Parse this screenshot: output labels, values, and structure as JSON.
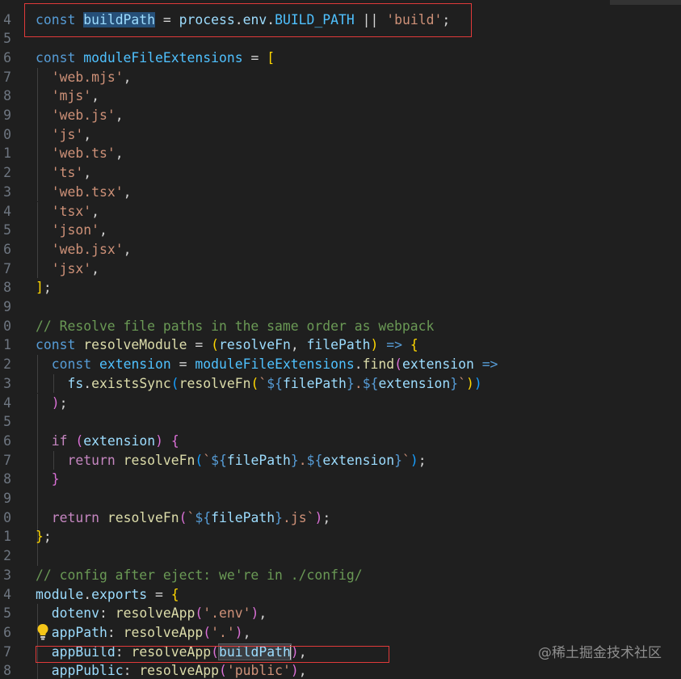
{
  "editor": {
    "colors": {
      "background": "#1f1f1f",
      "line_number": "#6e7681",
      "keyword": "#569cd6",
      "variable": "#9cdcfe",
      "constant": "#4fc1ff",
      "function": "#dcdcaa",
      "string": "#ce9178",
      "comment": "#6a9955",
      "control": "#c586c0",
      "punctuation": "#d4d4d4",
      "bracket_gold": "#ffd700",
      "bracket_pink": "#da70d6",
      "bracket_blue": "#179fff",
      "annotation_box": "#e03a3a"
    },
    "lines": [
      {
        "num": "4",
        "tokens": [
          [
            "const",
            "k"
          ],
          [
            " ",
            "p"
          ],
          [
            "buildPath",
            "vsel"
          ],
          [
            " = ",
            "p"
          ],
          [
            "process",
            "v"
          ],
          [
            ".",
            "p"
          ],
          [
            "env",
            "v"
          ],
          [
            ".",
            "p"
          ],
          [
            "BUILD_PATH",
            "c"
          ],
          [
            " || ",
            "p"
          ],
          [
            "'build'",
            "s"
          ],
          [
            ";",
            "p"
          ]
        ]
      },
      {
        "num": "5",
        "tokens": []
      },
      {
        "num": "6",
        "tokens": [
          [
            "const",
            "k"
          ],
          [
            " ",
            "p"
          ],
          [
            "moduleFileExtensions",
            "c"
          ],
          [
            " = ",
            "p"
          ],
          [
            "[",
            "b1"
          ]
        ]
      },
      {
        "num": "7",
        "tokens": [
          [
            "  ",
            "p"
          ],
          [
            "'web.mjs'",
            "s"
          ],
          [
            ",",
            "p"
          ]
        ]
      },
      {
        "num": "8",
        "tokens": [
          [
            "  ",
            "p"
          ],
          [
            "'mjs'",
            "s"
          ],
          [
            ",",
            "p"
          ]
        ]
      },
      {
        "num": "9",
        "tokens": [
          [
            "  ",
            "p"
          ],
          [
            "'web.js'",
            "s"
          ],
          [
            ",",
            "p"
          ]
        ]
      },
      {
        "num": "0",
        "tokens": [
          [
            "  ",
            "p"
          ],
          [
            "'js'",
            "s"
          ],
          [
            ",",
            "p"
          ]
        ]
      },
      {
        "num": "1",
        "tokens": [
          [
            "  ",
            "p"
          ],
          [
            "'web.ts'",
            "s"
          ],
          [
            ",",
            "p"
          ]
        ]
      },
      {
        "num": "2",
        "tokens": [
          [
            "  ",
            "p"
          ],
          [
            "'ts'",
            "s"
          ],
          [
            ",",
            "p"
          ]
        ]
      },
      {
        "num": "3",
        "tokens": [
          [
            "  ",
            "p"
          ],
          [
            "'web.tsx'",
            "s"
          ],
          [
            ",",
            "p"
          ]
        ]
      },
      {
        "num": "4",
        "tokens": [
          [
            "  ",
            "p"
          ],
          [
            "'tsx'",
            "s"
          ],
          [
            ",",
            "p"
          ]
        ]
      },
      {
        "num": "5",
        "tokens": [
          [
            "  ",
            "p"
          ],
          [
            "'json'",
            "s"
          ],
          [
            ",",
            "p"
          ]
        ]
      },
      {
        "num": "6",
        "tokens": [
          [
            "  ",
            "p"
          ],
          [
            "'web.jsx'",
            "s"
          ],
          [
            ",",
            "p"
          ]
        ]
      },
      {
        "num": "7",
        "tokens": [
          [
            "  ",
            "p"
          ],
          [
            "'jsx'",
            "s"
          ],
          [
            ",",
            "p"
          ]
        ]
      },
      {
        "num": "8",
        "tokens": [
          [
            "]",
            "b1"
          ],
          [
            ";",
            "p"
          ]
        ]
      },
      {
        "num": "9",
        "tokens": []
      },
      {
        "num": "0",
        "tokens": [
          [
            "// Resolve file paths in the same order as webpack",
            "cm"
          ]
        ]
      },
      {
        "num": "1",
        "tokens": [
          [
            "const",
            "k"
          ],
          [
            " ",
            "p"
          ],
          [
            "resolveModule",
            "f"
          ],
          [
            " = ",
            "p"
          ],
          [
            "(",
            "b1"
          ],
          [
            "resolveFn",
            "v"
          ],
          [
            ", ",
            "p"
          ],
          [
            "filePath",
            "v"
          ],
          [
            ")",
            "b1"
          ],
          [
            " ",
            "p"
          ],
          [
            "=>",
            "k"
          ],
          [
            " ",
            "p"
          ],
          [
            "{",
            "b1"
          ]
        ]
      },
      {
        "num": "2",
        "tokens": [
          [
            "  ",
            "p"
          ],
          [
            "const",
            "k"
          ],
          [
            " ",
            "p"
          ],
          [
            "extension",
            "c"
          ],
          [
            " = ",
            "p"
          ],
          [
            "moduleFileExtensions",
            "c"
          ],
          [
            ".",
            "p"
          ],
          [
            "find",
            "f"
          ],
          [
            "(",
            "b2"
          ],
          [
            "extension",
            "v"
          ],
          [
            " ",
            "p"
          ],
          [
            "=>",
            "k"
          ]
        ]
      },
      {
        "num": "3",
        "tokens": [
          [
            "    ",
            "p"
          ],
          [
            "fs",
            "v"
          ],
          [
            ".",
            "p"
          ],
          [
            "existsSync",
            "f"
          ],
          [
            "(",
            "b3"
          ],
          [
            "resolveFn",
            "f"
          ],
          [
            "(",
            "b1"
          ],
          [
            "`",
            "s"
          ],
          [
            "${",
            "k"
          ],
          [
            "filePath",
            "v"
          ],
          [
            "}",
            "k"
          ],
          [
            ".",
            "s"
          ],
          [
            "${",
            "k"
          ],
          [
            "extension",
            "v"
          ],
          [
            "}",
            "k"
          ],
          [
            "`",
            "s"
          ],
          [
            ")",
            "b1"
          ],
          [
            ")",
            "b3"
          ]
        ]
      },
      {
        "num": "4",
        "tokens": [
          [
            "  ",
            "p"
          ],
          [
            ")",
            "b2"
          ],
          [
            ";",
            "p"
          ]
        ]
      },
      {
        "num": "5",
        "tokens": []
      },
      {
        "num": "6",
        "tokens": [
          [
            "  ",
            "p"
          ],
          [
            "if",
            "ctl"
          ],
          [
            " ",
            "p"
          ],
          [
            "(",
            "b2"
          ],
          [
            "extension",
            "v"
          ],
          [
            ")",
            "b2"
          ],
          [
            " ",
            "p"
          ],
          [
            "{",
            "b2"
          ]
        ]
      },
      {
        "num": "7",
        "tokens": [
          [
            "    ",
            "p"
          ],
          [
            "return",
            "ctl"
          ],
          [
            " ",
            "p"
          ],
          [
            "resolveFn",
            "f"
          ],
          [
            "(",
            "b3"
          ],
          [
            "`",
            "s"
          ],
          [
            "${",
            "k"
          ],
          [
            "filePath",
            "v"
          ],
          [
            "}",
            "k"
          ],
          [
            ".",
            "s"
          ],
          [
            "${",
            "k"
          ],
          [
            "extension",
            "v"
          ],
          [
            "}",
            "k"
          ],
          [
            "`",
            "s"
          ],
          [
            ")",
            "b3"
          ],
          [
            ";",
            "p"
          ]
        ]
      },
      {
        "num": "8",
        "tokens": [
          [
            "  ",
            "p"
          ],
          [
            "}",
            "b2"
          ]
        ]
      },
      {
        "num": "9",
        "tokens": []
      },
      {
        "num": "0",
        "tokens": [
          [
            "  ",
            "p"
          ],
          [
            "return",
            "ctl"
          ],
          [
            " ",
            "p"
          ],
          [
            "resolveFn",
            "f"
          ],
          [
            "(",
            "b2"
          ],
          [
            "`",
            "s"
          ],
          [
            "${",
            "k"
          ],
          [
            "filePath",
            "v"
          ],
          [
            "}",
            "k"
          ],
          [
            ".js`",
            "s"
          ],
          [
            ")",
            "b2"
          ],
          [
            ";",
            "p"
          ]
        ]
      },
      {
        "num": "1",
        "tokens": [
          [
            "}",
            "b1"
          ],
          [
            ";",
            "p"
          ]
        ]
      },
      {
        "num": "2",
        "tokens": []
      },
      {
        "num": "3",
        "tokens": [
          [
            "// config after eject: we're in ./config/",
            "cm"
          ]
        ]
      },
      {
        "num": "4",
        "tokens": [
          [
            "module",
            "v"
          ],
          [
            ".",
            "p"
          ],
          [
            "exports",
            "v"
          ],
          [
            " = ",
            "p"
          ],
          [
            "{",
            "b1"
          ]
        ]
      },
      {
        "num": "5",
        "tokens": [
          [
            "  ",
            "p"
          ],
          [
            "dotenv",
            "v"
          ],
          [
            ": ",
            "p"
          ],
          [
            "resolveApp",
            "f"
          ],
          [
            "(",
            "b2"
          ],
          [
            "'.env'",
            "s"
          ],
          [
            ")",
            "b2"
          ],
          [
            ",",
            "p"
          ]
        ]
      },
      {
        "num": "6",
        "tokens": [
          [
            "  ",
            "p"
          ],
          [
            "appPath",
            "v"
          ],
          [
            ": ",
            "p"
          ],
          [
            "resolveApp",
            "f"
          ],
          [
            "(",
            "b2"
          ],
          [
            "'.'",
            "s"
          ],
          [
            ")",
            "b2"
          ],
          [
            ",",
            "p"
          ]
        ]
      },
      {
        "num": "7",
        "tokens": [
          [
            "  ",
            "p"
          ],
          [
            "appBuild",
            "v"
          ],
          [
            ": ",
            "p"
          ],
          [
            "resolveApp",
            "f"
          ],
          [
            "(",
            "b2"
          ],
          [
            "buildPath",
            "vref"
          ],
          [
            "|",
            "cur"
          ],
          [
            ")",
            "b2"
          ],
          [
            ",",
            "p"
          ]
        ]
      },
      {
        "num": "8",
        "tokens": [
          [
            "  ",
            "p"
          ],
          [
            "appPublic",
            "v"
          ],
          [
            ": ",
            "p"
          ],
          [
            "resolveApp",
            "f"
          ],
          [
            "(",
            "b2"
          ],
          [
            "'public'",
            "s"
          ],
          [
            ")",
            "b2"
          ],
          [
            ",",
            "p"
          ]
        ]
      }
    ]
  },
  "watermark": "@稀土掘金技术社区",
  "icons": {
    "lightbulb": "lightbulb-icon"
  }
}
